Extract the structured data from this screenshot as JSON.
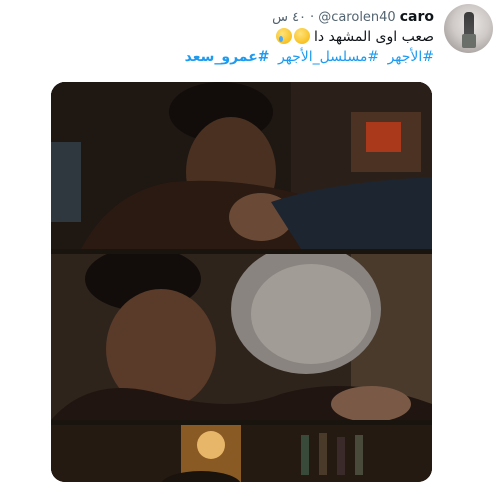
{
  "tweet": {
    "display_name": "caro",
    "handle": "@carolen40",
    "separator": "·",
    "timestamp": "٤٠ س",
    "text_line1": "صعب اوى المشهد دا",
    "hashtags": [
      "#الأجهر",
      "#مسلسل_الأجهر",
      "#عمرو_سعد"
    ],
    "emojis": [
      "hugging-face-emoji",
      "crying-face-emoji"
    ]
  },
  "media": {
    "frames": 3
  }
}
